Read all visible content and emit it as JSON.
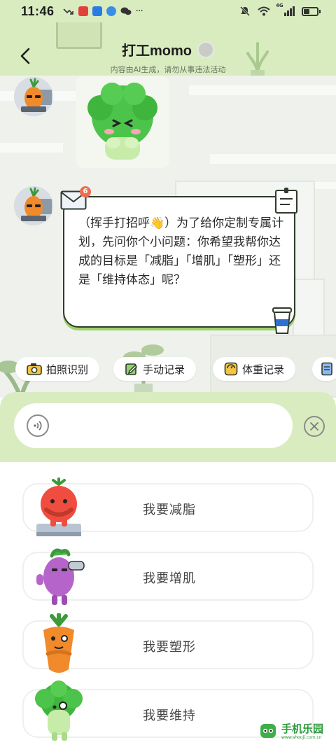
{
  "status_bar": {
    "time": "11:46",
    "network": "4G",
    "icons_left": [
      "missed-call-icon",
      "red-app-icon",
      "blue-app-icon",
      "browser-app-icon",
      "wechat-icon",
      "more-dots-icon"
    ],
    "icons_right": [
      "mute-icon",
      "wifi-icon",
      "signal-icon",
      "battery-icon"
    ]
  },
  "header": {
    "title": "打工momo",
    "disclaimer": "内容由AI生成，请勿从事违法活动"
  },
  "chat": {
    "message": "（挥手打招呼👋）为了给你定制专属计划，先问你个小问题：你希望我帮你达成的目标是「减脂」「增肌」「塑形」还是「维持体态」呢？",
    "mail_badge": "6"
  },
  "quick_actions": [
    {
      "label": "拍照识别",
      "icon": "camera-icon"
    },
    {
      "label": "手动记录",
      "icon": "edit-note-icon"
    },
    {
      "label": "体重记录",
      "icon": "scale-icon"
    }
  ],
  "input": {
    "placeholder": ""
  },
  "options": [
    {
      "label": "我要减脂",
      "mascot": "tomato-mascot"
    },
    {
      "label": "我要增肌",
      "mascot": "eggplant-mascot"
    },
    {
      "label": "我要塑形",
      "mascot": "carrot-mascot"
    },
    {
      "label": "我要维持",
      "mascot": "broccoli-mascot"
    }
  ],
  "watermark": {
    "text": "手机乐园",
    "sub": "www.shouji.com.cn"
  },
  "colors": {
    "accent_green": "#d9ecc0",
    "bubble_shadow": "#9fd36a",
    "badge_red": "#ef6b4d"
  }
}
